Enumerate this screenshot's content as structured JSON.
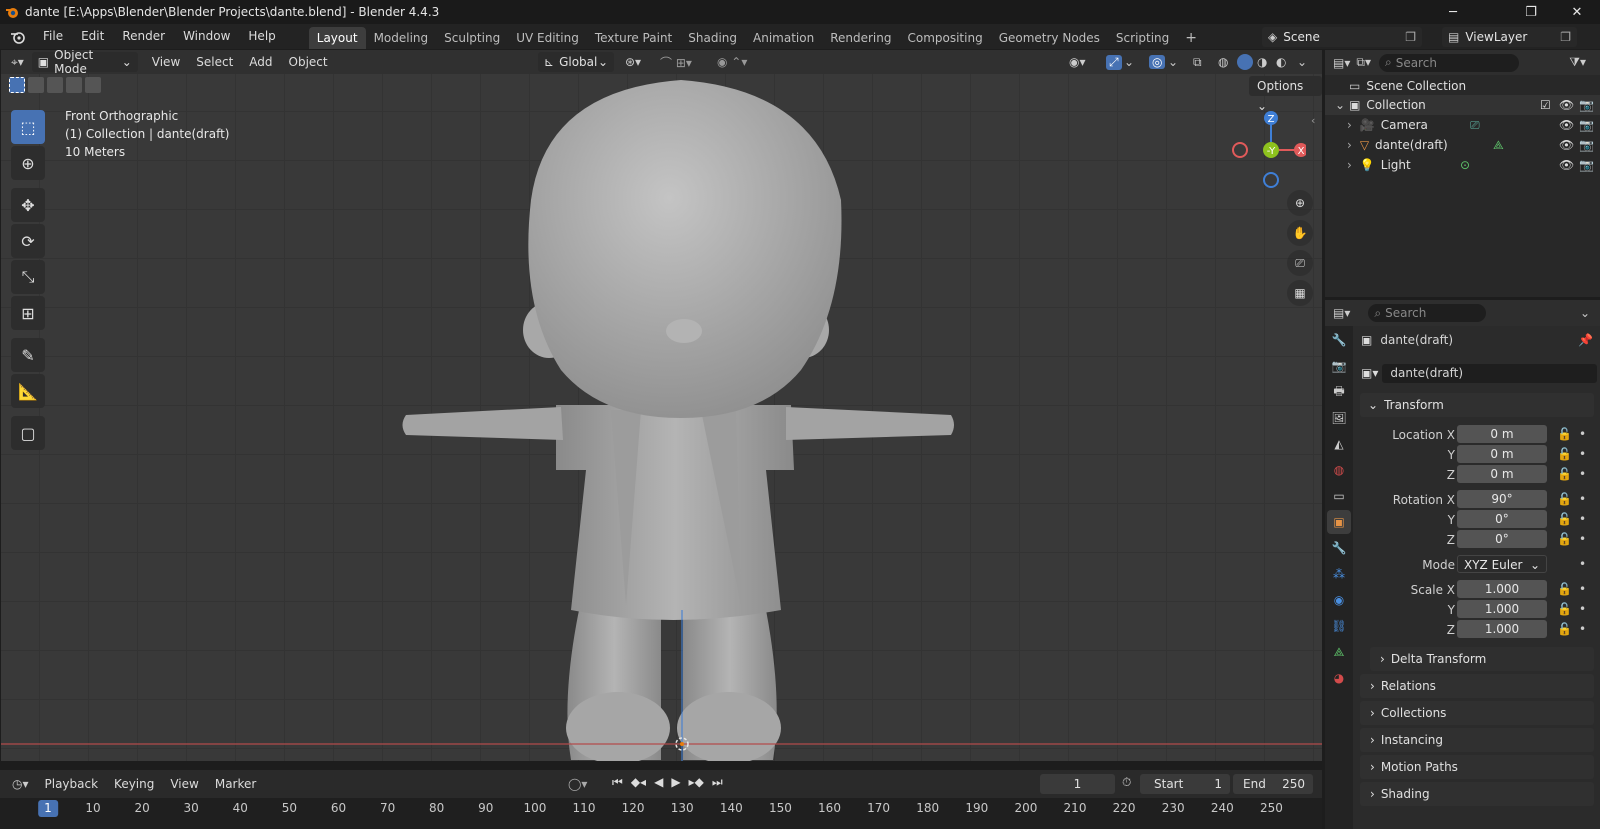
{
  "window": {
    "title": "dante [E:\\Apps\\Blender\\Blender Projects\\dante.blend] - Blender 4.4.3",
    "minimize": "─",
    "maximize": "❐",
    "close": "✕"
  },
  "menu": [
    "File",
    "Edit",
    "Render",
    "Window",
    "Help"
  ],
  "workspaces": [
    "Layout",
    "Modeling",
    "Sculpting",
    "UV Editing",
    "Texture Paint",
    "Shading",
    "Animation",
    "Rendering",
    "Compositing",
    "Geometry Nodes",
    "Scripting"
  ],
  "active_workspace": "Layout",
  "add_workspace": "+",
  "scene_name": "Scene",
  "view_layer": "ViewLayer",
  "viewport": {
    "mode": "Object Mode",
    "menus": [
      "View",
      "Select",
      "Add",
      "Object"
    ],
    "orientation": "Global",
    "options_label": "Options",
    "info": [
      "Front Orthographic",
      "(1) Collection | dante(draft)",
      "10 Meters"
    ],
    "gizmo": {
      "z": "Z",
      "y": "-Y",
      "x": "X"
    }
  },
  "outliner": {
    "search_placeholder": "Search",
    "scene_collection": "Scene Collection",
    "collection": "Collection",
    "items": [
      "Camera",
      "dante(draft)",
      "Light"
    ]
  },
  "properties": {
    "search_placeholder": "Search",
    "object_title": "dante(draft)",
    "object_name": "dante(draft)",
    "transform_label": "Transform",
    "location_label": "Location X",
    "location": [
      "0 m",
      "0 m",
      "0 m"
    ],
    "rotation_label": "Rotation X",
    "rotation": [
      "90°",
      "0°",
      "0°"
    ],
    "y_label": "Y",
    "z_label": "Z",
    "mode_label": "Mode",
    "mode_value": "XYZ Euler",
    "scale_label": "Scale X",
    "scale": [
      "1.000",
      "1.000",
      "1.000"
    ],
    "delta_transform": "Delta Transform",
    "sections": [
      "Relations",
      "Collections",
      "Instancing",
      "Motion Paths",
      "Shading"
    ]
  },
  "timeline": {
    "menus": [
      "Playback",
      "Keying",
      "View",
      "Marker"
    ],
    "current_frame": "1",
    "start_label": "Start",
    "start": "1",
    "end_label": "End",
    "end": "250",
    "ruler": [
      "1",
      "10",
      "20",
      "30",
      "40",
      "50",
      "60",
      "70",
      "80",
      "90",
      "100",
      "110",
      "120",
      "130",
      "140",
      "150",
      "160",
      "170",
      "180",
      "190",
      "200",
      "210",
      "220",
      "230",
      "240",
      "250"
    ]
  },
  "colors": {
    "accent": "#4772b3",
    "axis_x": "#e05a5a",
    "axis_y": "#8ec21e",
    "axis_z": "#3f7fd6",
    "viewport_bg": "#393939"
  }
}
